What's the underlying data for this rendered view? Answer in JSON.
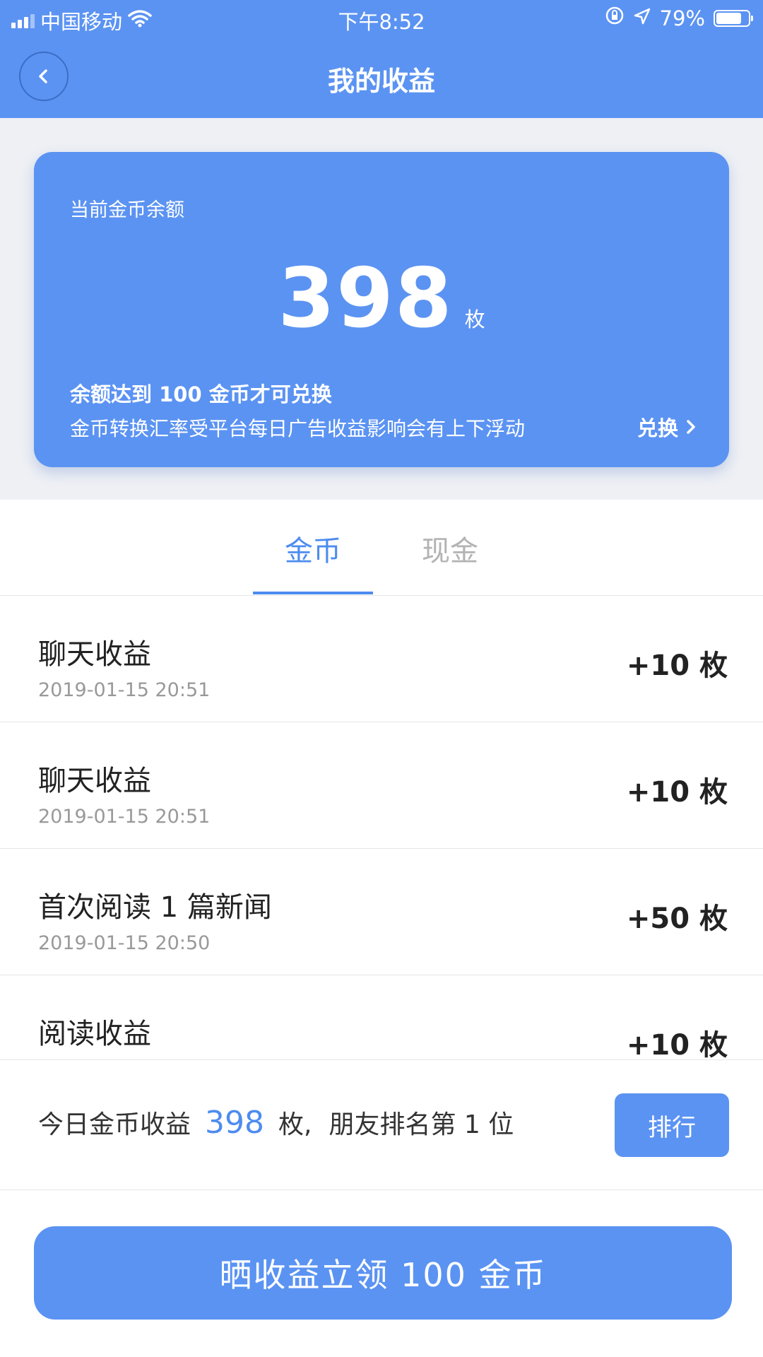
{
  "status_bar": {
    "carrier": "中国移动",
    "time": "下午8:52",
    "battery_text": "79%",
    "battery_level": 0.79,
    "icons": [
      "signal-icon",
      "wifi-icon",
      "orientation-lock-icon",
      "location-icon",
      "battery-icon"
    ]
  },
  "header": {
    "title": "我的收益",
    "back_icon": "chevron-left-icon"
  },
  "balance_card": {
    "label": "当前金币余额",
    "value": "398",
    "unit": "枚",
    "note1": "余额达到 100 金币才可兑换",
    "note2": "金币转换汇率受平台每日广告收益影响会有上下浮动",
    "exchange_label": "兑换",
    "exchange_icon": "chevron-right-icon"
  },
  "tabs": [
    {
      "label": "金币",
      "active": true
    },
    {
      "label": "现金",
      "active": false
    }
  ],
  "records": [
    {
      "title": "聊天收益",
      "time": "2019-01-15 20:51",
      "amount": "+10 枚"
    },
    {
      "title": "聊天收益",
      "time": "2019-01-15 20:51",
      "amount": "+10 枚"
    },
    {
      "title": "首次阅读 1 篇新闻",
      "time": "2019-01-15 20:50",
      "amount": "+50 枚"
    },
    {
      "title": "阅读收益",
      "time": "",
      "amount": "+10 枚"
    }
  ],
  "summary": {
    "prefix": "今日金币收益",
    "value": "398",
    "unit": "枚,",
    "rank_text": "朋友排名第 1 位",
    "rank_button": "排行"
  },
  "share_button": "晒收益立领 100 金币",
  "colors": {
    "primary": "#5b93f2",
    "accent_text": "#4d8cf0",
    "inactive_tab": "#b3b3b3",
    "page_bg": "#eef0f4"
  }
}
